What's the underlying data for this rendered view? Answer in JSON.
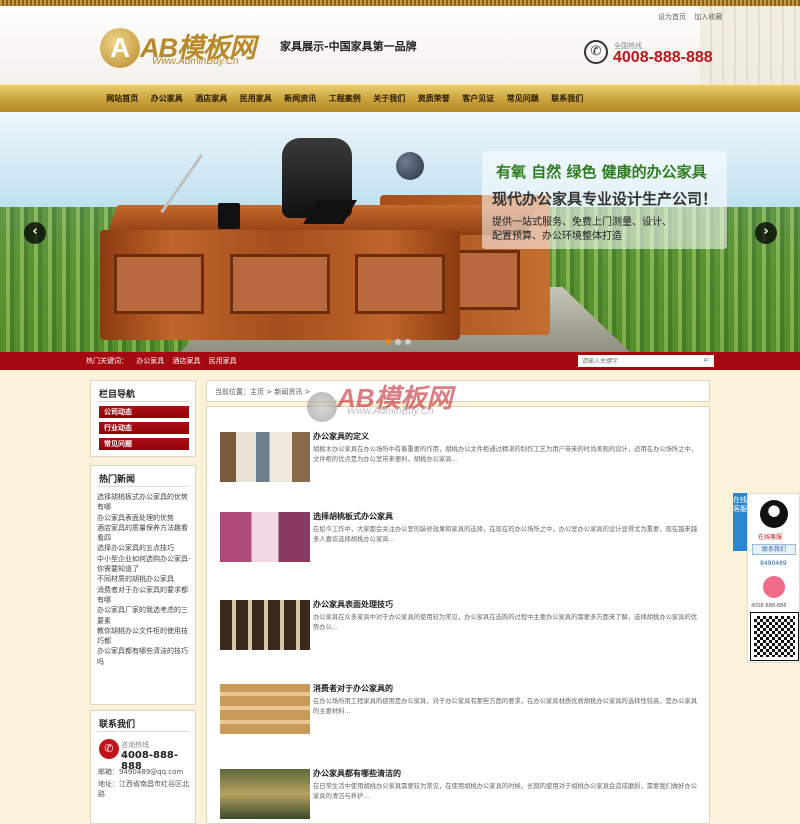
{
  "header": {
    "toplinks": [
      "设为首页",
      "加入收藏"
    ],
    "logo_name": "AB模板网",
    "logo_sub": "Www.AdminBuy.Cn",
    "slogan": "家具展示-中国家具第一品牌",
    "phone_label": "全国热线",
    "phone": "4008-888-888"
  },
  "nav": [
    "网站首页",
    "办公家具",
    "酒店家具",
    "民用家具",
    "新闻资讯",
    "工程案例",
    "关于我们",
    "资质荣誉",
    "客户见证",
    "常见问题",
    "联系我们"
  ],
  "banner": {
    "line1": "有氧 自然 绿色 健康的办公家具",
    "line2": "现代办公家具专业设计生产公司！",
    "line3": "提供一站式服务、免费上门测量、设计、",
    "line4": "配置预算、办公环境整体打造",
    "prev": "‹",
    "next": "›"
  },
  "keywords": {
    "label": "热门关键词：",
    "items": [
      "办公家具",
      "酒店家具",
      "民用家具"
    ],
    "search_placeholder": "请输入关键字",
    "search_icon": "magnifier-icon"
  },
  "sidebar": {
    "nav_title": "栏目导航",
    "nav_items": [
      "公司动态",
      "行业动态",
      "常见问题"
    ],
    "news_title": "热门新闻",
    "news": [
      "选择胡桃板式办公家具的优势有哪",
      "办公家具表面处理的优势",
      "酒店家具的质量保养方法趣看看四",
      "选择办公家具的五点技巧",
      "中小型企业如何选购办公家具-你需要知道了",
      "不同材质的胡桃办公家具",
      "消费者对于办公家具的要求都有哪",
      "办公家具厂家的我选考虑的三要素",
      "教你胡桃办公文件柜的使用技巧都",
      "办公家具都有哪些清洁的技巧吗"
    ],
    "contact_title": "联系我们",
    "contact_label": "咨询热线",
    "contact_phone": "4008-888-888",
    "contact_lines": [
      "邮箱：9490489@qq.com",
      "地址：江西省南昌市红谷区北路"
    ]
  },
  "main": {
    "breadcrumb": "当前位置：主页 > 新闻资讯 >",
    "watermark_name": "AB模板网",
    "watermark_sub": "Www.AdminBuy.Cn",
    "items": [
      {
        "title": "办公家具的定义",
        "desc": "胡桃木办公家具在办公场所中有着重要的作用，胡桃办公文件柜通过精湛的制作工艺为用户带来的时尚美观的设计，适用在办公场所之中，文件柜的优点是为办公室带来便利，胡桃办公家具..."
      },
      {
        "title": "选择胡桃板式办公家具",
        "desc": "在如今工作中，大家都会关注办公室的装修效果和家具的选择，在现在的办公场所之中，办公室办公家具的设计显得尤为重要，现在越来越多人喜欢选择胡桃办公家具..."
      },
      {
        "title": "办公家具表面处理技巧",
        "desc": "办公家具在众多家具中对于办公家具的使用较为常见，办公家具在选购的过程中主要办公家具的需要多方面来了解，选择胡桃办公家具的优势办公..."
      },
      {
        "title": "消费者对于办公家具的",
        "desc": "在办公场所用工程家具的使用是办公家具，对于办公家具有那些方面的要求，在办公家具材质优质胡桃办公家具的选择性较高，是办公家具的主要材料..."
      },
      {
        "title": "办公家具都有哪些清洁的",
        "desc": "在日常生活中使用胡桃办公家具需要较为常见，在使用胡桃办公家具的时候，长期的使用对于胡桃办公家具会造成磨损，需要我们做好办公家具的清洁与养护..."
      }
    ]
  },
  "float": {
    "tab": "在线客服",
    "qq_label": "在线客服",
    "qq_button": "联系我们",
    "qq_number": "9490489",
    "tel": "4008-888-888"
  },
  "icons": {
    "phone": "phone-icon",
    "qq": "qq-penguin-icon",
    "qr": "qr-code-icon"
  },
  "colors": {
    "brand_red": "#a5080e",
    "gold": "#c9a23c",
    "background": "#fbf3d9"
  }
}
